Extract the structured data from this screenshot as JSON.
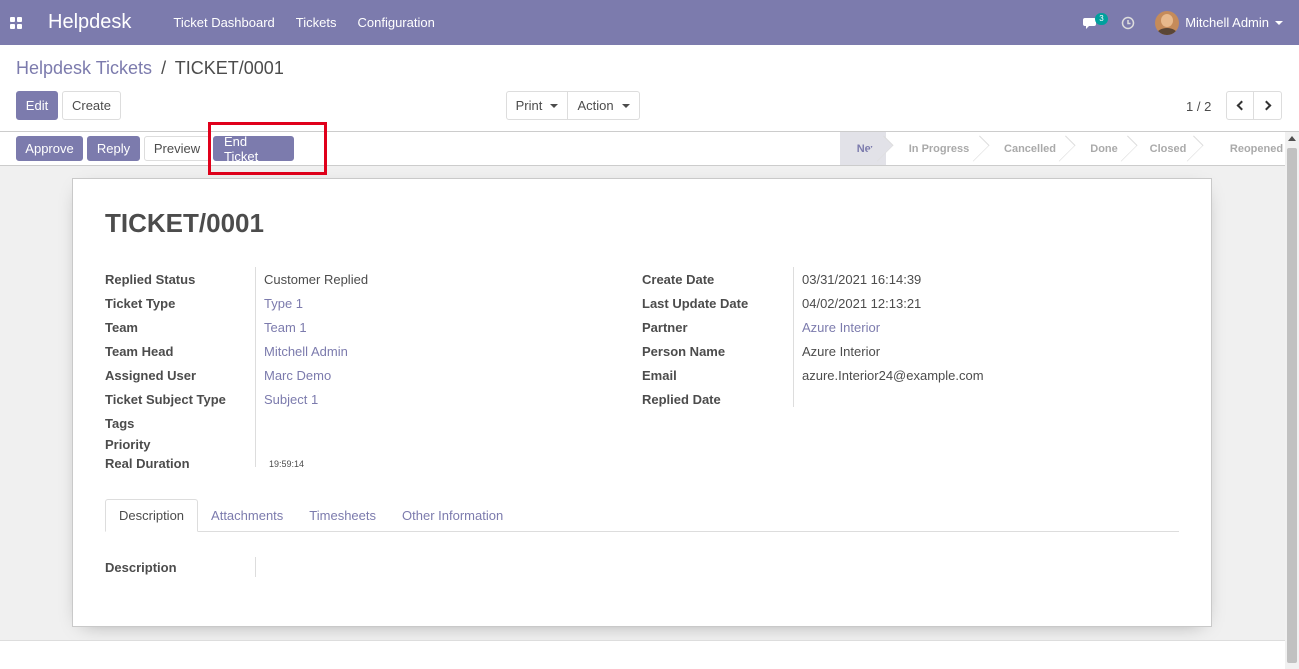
{
  "navbar": {
    "brand": "Helpdesk",
    "menu": [
      "Ticket Dashboard",
      "Tickets",
      "Configuration"
    ],
    "message_count": "3",
    "user_name": "Mitchell Admin"
  },
  "breadcrumb": {
    "parent": "Helpdesk Tickets",
    "separator": "/",
    "current": "TICKET/0001"
  },
  "buttons": {
    "edit": "Edit",
    "create": "Create",
    "print": "Print",
    "action": "Action"
  },
  "pager": {
    "value": "1 / 2"
  },
  "statusbar": {
    "approve": "Approve",
    "reply": "Reply",
    "preview": "Preview",
    "end_ticket": "End Ticket",
    "stages": [
      "New",
      "In Progress",
      "Cancelled",
      "Done",
      "Closed",
      "Reopened"
    ],
    "current_stage": "New"
  },
  "ticket": {
    "title": "TICKET/0001",
    "left": [
      {
        "label": "Replied Status",
        "value": "Customer Replied"
      },
      {
        "label": "Ticket Type",
        "value": "Type 1"
      },
      {
        "label": "Team",
        "value": "Team 1"
      },
      {
        "label": "Team Head",
        "value": "Mitchell Admin"
      },
      {
        "label": "Assigned User",
        "value": "Marc Demo"
      },
      {
        "label": "Ticket Subject Type",
        "value": "Subject 1"
      },
      {
        "label": "Tags",
        "value": ""
      },
      {
        "label": "Priority",
        "value": ""
      },
      {
        "label": "Real Duration",
        "value": "19:59:14"
      }
    ],
    "right": [
      {
        "label": "Create Date",
        "value": "03/31/2021 16:14:39"
      },
      {
        "label": "Last Update Date",
        "value": "04/02/2021 12:13:21"
      },
      {
        "label": "Partner",
        "value": "Azure Interior"
      },
      {
        "label": "Person Name",
        "value": "Azure Interior"
      },
      {
        "label": "Email",
        "value": "azure.Interior24@example.com"
      },
      {
        "label": "Replied Date",
        "value": ""
      }
    ]
  },
  "tabs": [
    "Description",
    "Attachments",
    "Timesheets",
    "Other Information"
  ],
  "description_label": "Description",
  "colors": {
    "primary": "#7c7bad",
    "highlight": "#e0001b",
    "badge": "#00a09d"
  }
}
